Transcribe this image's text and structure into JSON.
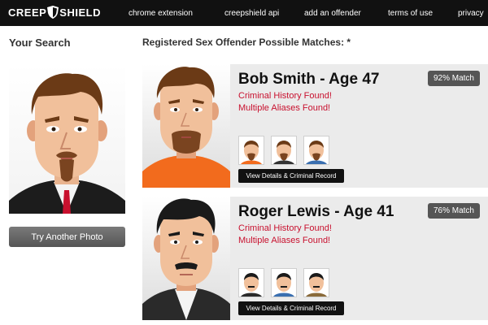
{
  "brand": {
    "logo_left": "CREEP",
    "logo_right": "SHIELD"
  },
  "nav": {
    "items": [
      "chrome extension",
      "creepshield api",
      "add an offender",
      "terms of use",
      "privacy"
    ]
  },
  "left": {
    "heading": "Your Search",
    "try_button": "Try Another Photo"
  },
  "main": {
    "heading": "Registered Sex Offender Possible Matches: *",
    "results": [
      {
        "name": "Bob Smith - Age 47",
        "match": "92% Match",
        "alert1": "Criminal History Found!",
        "alert2": "Multiple Aliases Found!",
        "button": "View Details & Criminal Record",
        "shirt_color": "#f26b1d",
        "hair_color": "#6b3a16"
      },
      {
        "name": "Roger Lewis - Age 41",
        "match": "76% Match",
        "alert1": "Criminal History Found!",
        "alert2": "Multiple Aliases Found!",
        "button": "View Details & Criminal Record",
        "shirt_color": "#2a2a2a",
        "hair_color": "#1a1a1a"
      }
    ]
  },
  "colors": {
    "alert": "#c8102e",
    "topbar": "#111111",
    "card_bg": "#ebebeb"
  }
}
